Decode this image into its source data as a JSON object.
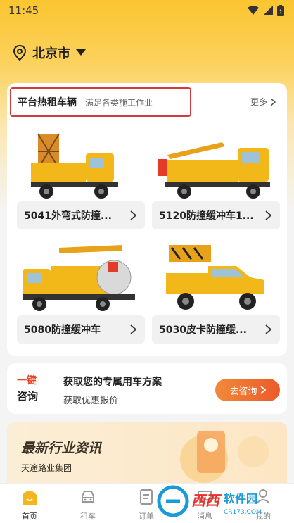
{
  "status": {
    "time": "11:45"
  },
  "location": {
    "city": "北京市"
  },
  "hot": {
    "title": "平台热租车辆",
    "subtitle": "满足各类施工作业",
    "more": "更多"
  },
  "vehicles": [
    {
      "name": "5041外弯式防撞..."
    },
    {
      "name": "5120防撞缓冲车1..."
    },
    {
      "name": "5080防撞缓冲车"
    },
    {
      "name": "5030皮卡防撞缓..."
    }
  ],
  "consult": {
    "badge_top": "一键",
    "badge_bottom": "咨询",
    "line1": "获取您的专属用车方案",
    "line2": "获取优惠报价",
    "button": "去咨询"
  },
  "news": {
    "title": "最新行业资讯",
    "subtitle": "天途路业集团"
  },
  "tabs": [
    {
      "label": "首页",
      "icon": "home-icon",
      "active": true
    },
    {
      "label": "租车",
      "icon": "car-icon",
      "active": false
    },
    {
      "label": "订单",
      "icon": "order-icon",
      "active": false
    },
    {
      "label": "消息",
      "icon": "message-icon",
      "active": false
    },
    {
      "label": "我的",
      "icon": "profile-icon",
      "active": false
    }
  ],
  "watermark": {
    "text": "西西软件园",
    "url_text": "CR173.COM"
  },
  "colors": {
    "brand_yellow": "#fbc530",
    "accent_orange": "#ec5a2a",
    "highlight_red": "#d23b3b"
  }
}
